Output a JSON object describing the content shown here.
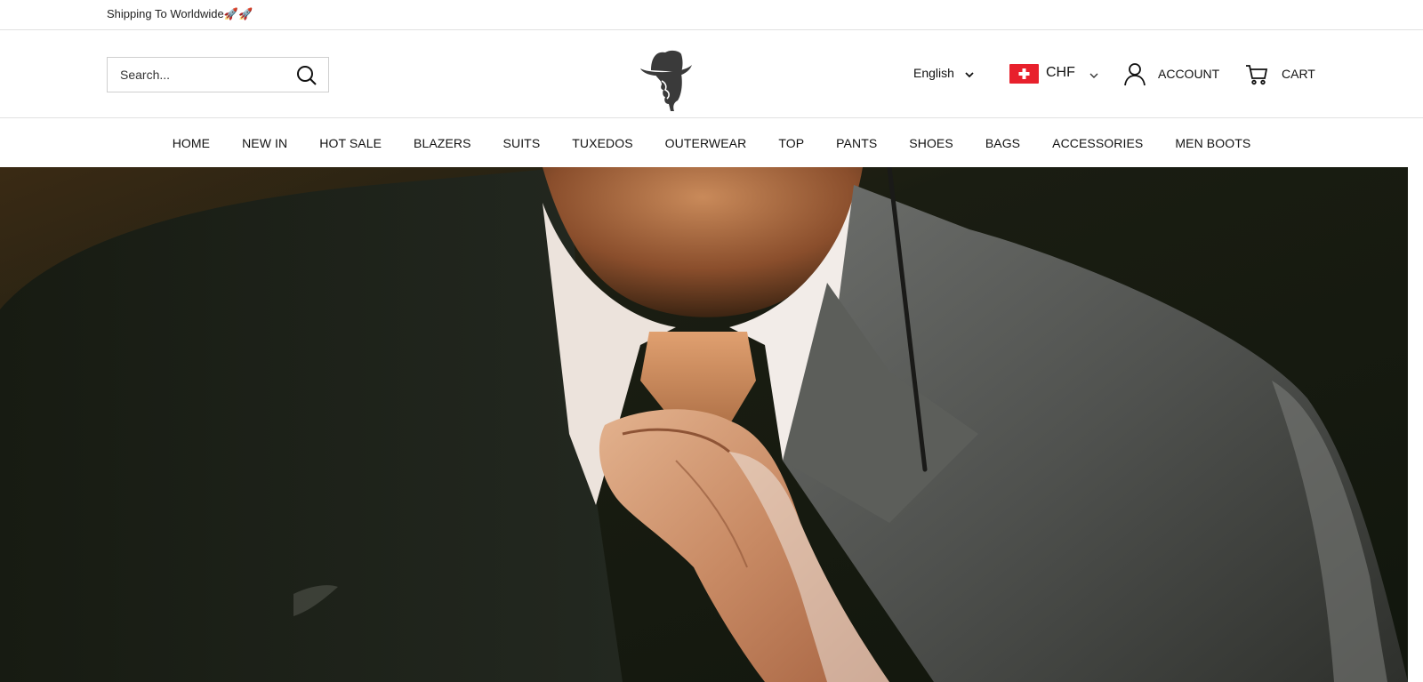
{
  "topbar": {
    "message": "Shipping To Worldwide🚀🚀"
  },
  "header": {
    "search": {
      "placeholder": "Search...",
      "value": ""
    },
    "language": {
      "selected": "English"
    },
    "currency": {
      "selected": "CHF",
      "flag": "switzerland-flag"
    },
    "account_label": "ACCOUNT",
    "cart_label": "CART",
    "logo": "gentleman-hat-logo"
  },
  "nav": {
    "items": [
      {
        "label": "HOME"
      },
      {
        "label": "NEW IN"
      },
      {
        "label": "HOT SALE"
      },
      {
        "label": "BLAZERS"
      },
      {
        "label": "SUITS"
      },
      {
        "label": "TUXEDOS"
      },
      {
        "label": "OUTERWEAR"
      },
      {
        "label": "TOP"
      },
      {
        "label": "PANTS"
      },
      {
        "label": "SHOES"
      },
      {
        "label": "BAGS"
      },
      {
        "label": "ACCESSORIES"
      },
      {
        "label": "MEN BOOTS"
      }
    ]
  },
  "hero": {
    "image": "man-in-suit-adjusting-tie-photo"
  },
  "colors": {
    "accent": "#e8202c",
    "text": "#111111",
    "border": "#e2e2e2"
  }
}
